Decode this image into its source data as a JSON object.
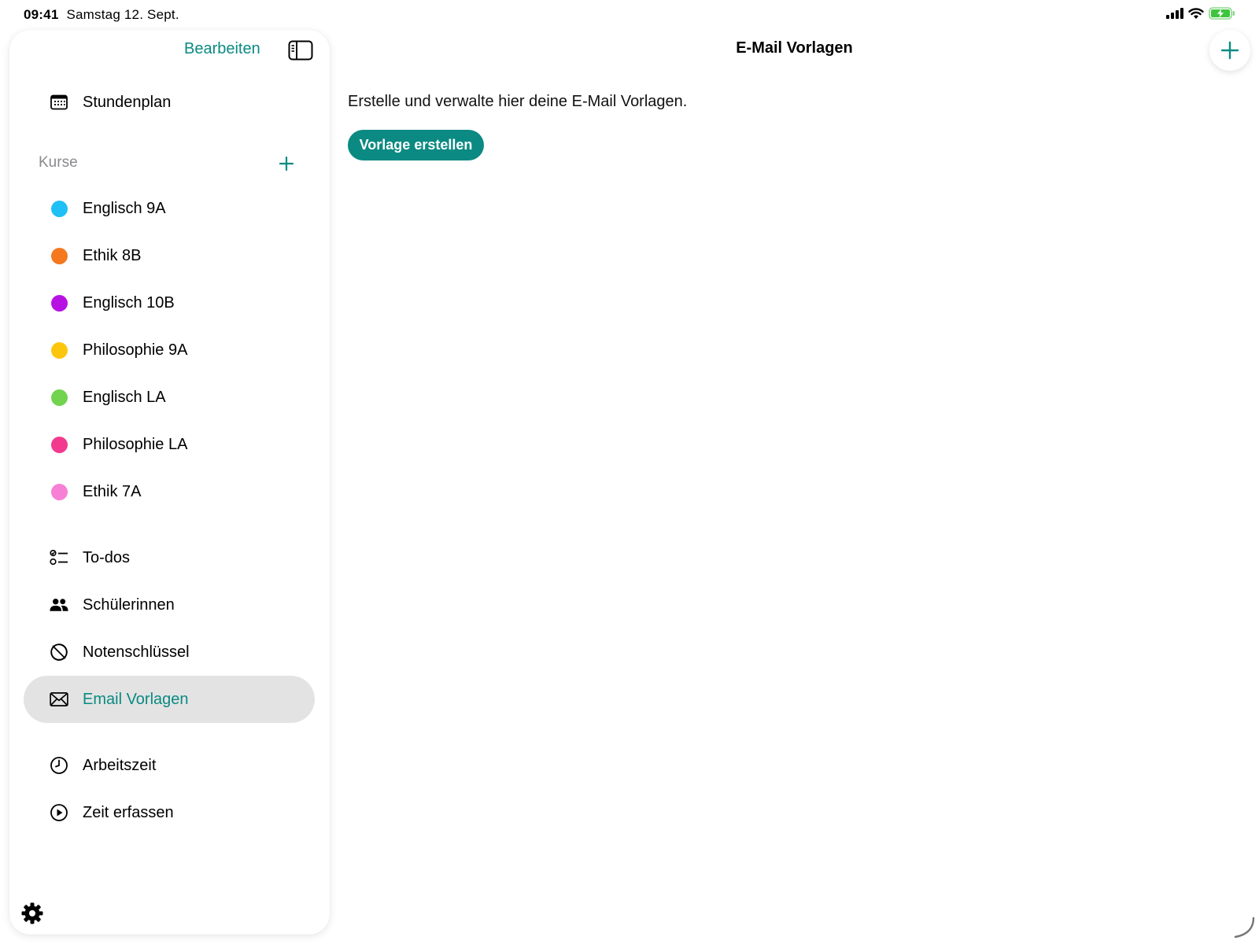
{
  "status": {
    "time": "09:41",
    "date": "Samstag 12. Sept."
  },
  "sidebar": {
    "edit_label": "Bearbeiten",
    "schedule_label": "Stundenplan",
    "courses_section_label": "Kurse",
    "courses": [
      {
        "label": "Englisch 9A",
        "color": "#1ec0f5"
      },
      {
        "label": "Ethik 8B",
        "color": "#f5781e"
      },
      {
        "label": "Englisch 10B",
        "color": "#b712e3"
      },
      {
        "label": "Philosophie 9A",
        "color": "#fcc60f"
      },
      {
        "label": "Englisch LA",
        "color": "#72d34f"
      },
      {
        "label": "Philosophie LA",
        "color": "#f23a8e"
      },
      {
        "label": "Ethik 7A",
        "color": "#f77fd6"
      }
    ],
    "tools": [
      {
        "label": "To-dos",
        "icon": "checklist-icon"
      },
      {
        "label": "Schülerinnen",
        "icon": "people-icon"
      },
      {
        "label": "Notenschlüssel",
        "icon": "grade-key-icon"
      },
      {
        "label": "Email Vorlagen",
        "icon": "envelope-icon",
        "active": true
      }
    ],
    "time_items": [
      {
        "label": "Arbeitszeit",
        "icon": "clock-icon"
      },
      {
        "label": "Zeit erfassen",
        "icon": "play-circle-icon"
      }
    ]
  },
  "main": {
    "title": "E-Mail Vorlagen",
    "description": "Erstelle und verwalte hier deine E-Mail Vorlagen.",
    "create_button_label": "Vorlage erstellen"
  },
  "colors": {
    "accent": "#0a8a82",
    "active_background": "#e3e3e3"
  }
}
